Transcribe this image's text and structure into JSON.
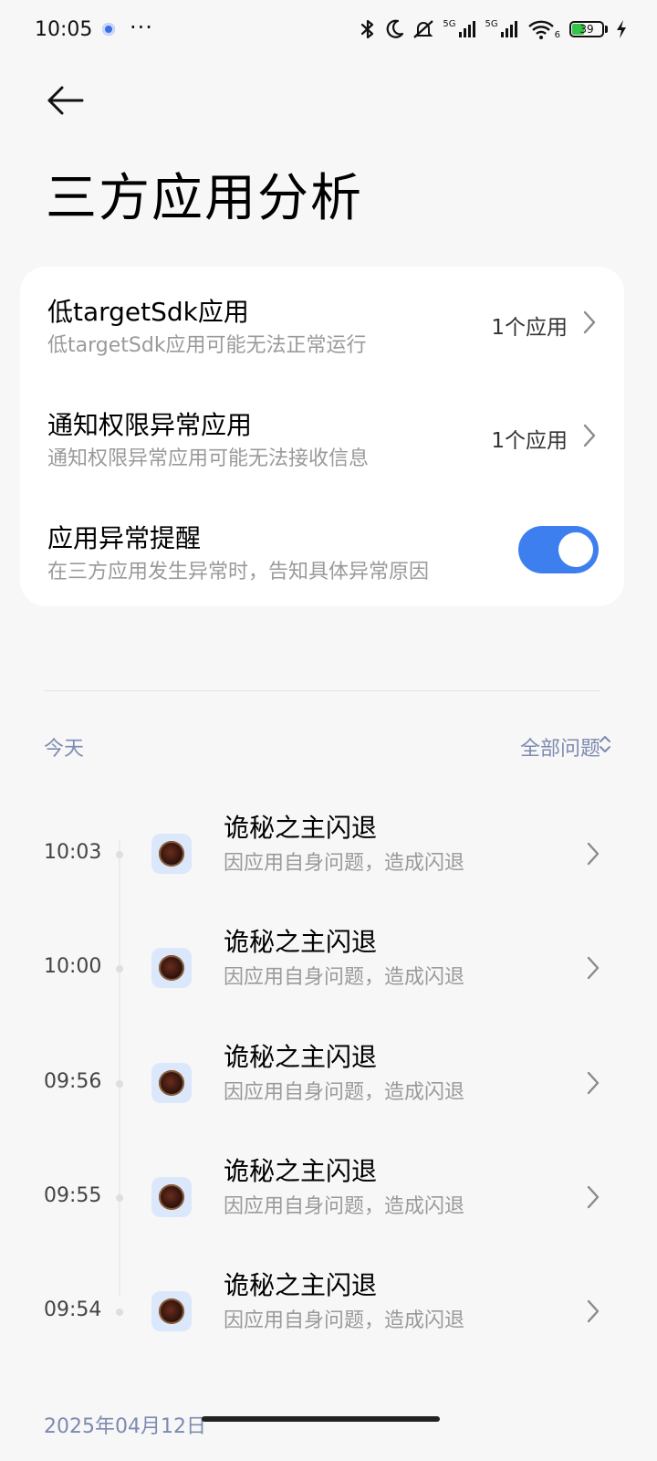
{
  "status_bar": {
    "time": "10:05",
    "more": "···",
    "signal1_label": "5G",
    "signal2_label": "5G",
    "wifi_label": "6",
    "battery_level": "39"
  },
  "page": {
    "title": "三方应用分析"
  },
  "settings": {
    "low_target": {
      "title": "低targetSdk应用",
      "desc": "低targetSdk应用可能无法正常运行",
      "value": "1个应用"
    },
    "notify_perm": {
      "title": "通知权限异常应用",
      "desc": "通知权限异常应用可能无法接收信息",
      "value": "1个应用"
    },
    "alert": {
      "title": "应用异常提醒",
      "desc": "在三方应用发生异常时，告知具体异常原因",
      "enabled": true
    }
  },
  "records": {
    "day_label": "今天",
    "filter_label": "全部问题",
    "events": [
      {
        "time": "10:03",
        "title": "诡秘之主闪退",
        "desc": "因应用自身问题，造成闪退"
      },
      {
        "time": "10:00",
        "title": "诡秘之主闪退",
        "desc": "因应用自身问题，造成闪退"
      },
      {
        "time": "09:56",
        "title": "诡秘之主闪退",
        "desc": "因应用自身问题，造成闪退"
      },
      {
        "time": "09:55",
        "title": "诡秘之主闪退",
        "desc": "因应用自身问题，造成闪退"
      },
      {
        "time": "09:54",
        "title": "诡秘之主闪退",
        "desc": "因应用自身问题，造成闪退"
      }
    ],
    "next_date": "2025年04月12日"
  },
  "icons": {
    "back": "arrow-left-icon",
    "chevron": "chevron-right-icon",
    "filter": "sort-updown-icon",
    "bluetooth": "bluetooth-icon",
    "dnd": "moon-icon",
    "mute": "bell-off-icon",
    "wifi": "wifi-icon",
    "charging": "bolt-icon"
  },
  "colors": {
    "accent": "#3e7ff0",
    "secondary_text": "#9a9a9a",
    "section_text": "#7d8bb0",
    "background": "#f7f7f7"
  }
}
